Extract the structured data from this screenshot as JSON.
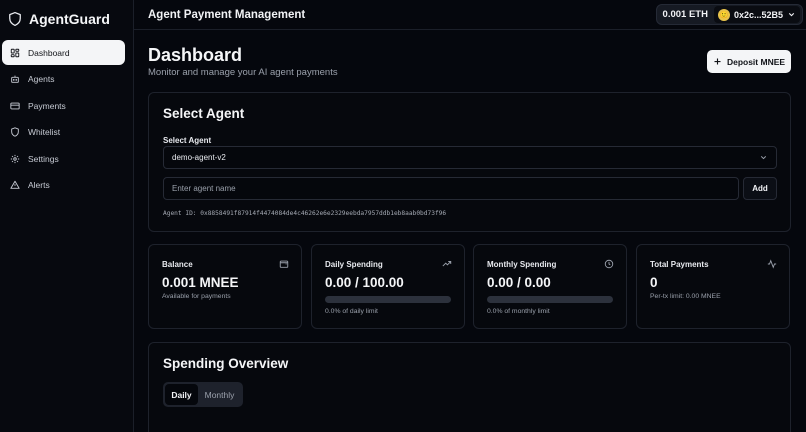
{
  "brand": {
    "name": "AgentGuard"
  },
  "sidebar": {
    "items": [
      {
        "label": "Dashboard",
        "icon": "dashboard-icon",
        "active": true
      },
      {
        "label": "Agents",
        "icon": "bot-icon"
      },
      {
        "label": "Payments",
        "icon": "card-icon"
      },
      {
        "label": "Whitelist",
        "icon": "shield-icon"
      },
      {
        "label": "Settings",
        "icon": "gear-icon"
      },
      {
        "label": "Alerts",
        "icon": "warning-icon"
      }
    ]
  },
  "header": {
    "title": "Agent Payment Management",
    "balance": "0.001 ETH",
    "address": "0x2c...52B5"
  },
  "page": {
    "title": "Dashboard",
    "subtitle": "Monitor and manage your AI agent payments",
    "deposit_label": "Deposit MNEE"
  },
  "select_agent": {
    "heading": "Select Agent",
    "field_label": "Select Agent",
    "selected": "demo-agent-v2",
    "input_placeholder": "Enter agent name",
    "add_label": "Add",
    "agent_id": "Agent ID: 0x8858491f87914f4474084de4c46262e6e2329eebda7957ddb1eb8aab0bd73f96"
  },
  "stats": [
    {
      "title": "Balance",
      "value": "0.001 MNEE",
      "sub": "Available for payments",
      "icon": "wallet-icon"
    },
    {
      "title": "Daily Spending",
      "value": "0.00 / 100.00",
      "sub": "0.0% of daily limit",
      "progress": 0,
      "icon": "trending-up-icon"
    },
    {
      "title": "Monthly Spending",
      "value": "0.00 / 0.00",
      "sub": "0.0% of monthly limit",
      "progress": 0,
      "icon": "clock-icon"
    },
    {
      "title": "Total Payments",
      "value": "0",
      "sub": "Per-tx limit: 0.00 MNEE",
      "icon": "activity-icon"
    }
  ],
  "overview": {
    "heading": "Spending Overview",
    "tabs": [
      "Daily",
      "Monthly"
    ]
  },
  "colors": {
    "accent": "#f4f5f7",
    "background": "#05070d",
    "card_border": "#1e222c"
  }
}
